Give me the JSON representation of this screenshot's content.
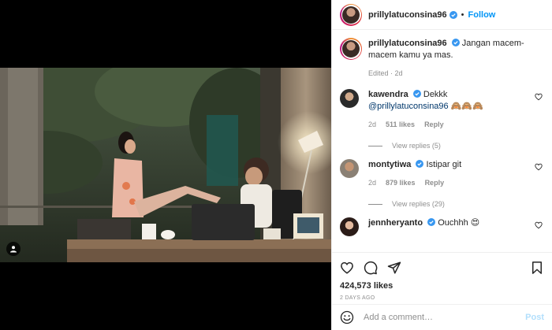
{
  "post": {
    "username": "prillylatuconsina96",
    "follow_label": "Follow",
    "dot": "•",
    "caption": "Jangan macem-macem kamu ya mas.",
    "caption_meta": "Edited · 2d",
    "likes": "424,573 likes",
    "date": "2 DAYS AGO"
  },
  "comments": [
    {
      "username": "kawendra",
      "text_prefix": "Dekkk ",
      "mention": "@prillylatuconsina96",
      "emoji": " 🙈🙈🙈",
      "age": "2d",
      "likes": "511 likes",
      "reply_label": "Reply",
      "view_replies": "View replies (5)"
    },
    {
      "username": "montytiwa",
      "text": "Istipar git",
      "age": "2d",
      "likes": "879 likes",
      "reply_label": "Reply",
      "view_replies": "View replies (29)"
    },
    {
      "username": "jennheryanto",
      "text": "Ouchhh 😍"
    }
  ],
  "add_comment": {
    "placeholder": "Add a comment…",
    "post_label": "Post"
  },
  "colors": {
    "accent": "#0095f6",
    "verified": "#3897f0",
    "muted": "#8e8e8e",
    "post_disabled": "#b2dffc"
  }
}
